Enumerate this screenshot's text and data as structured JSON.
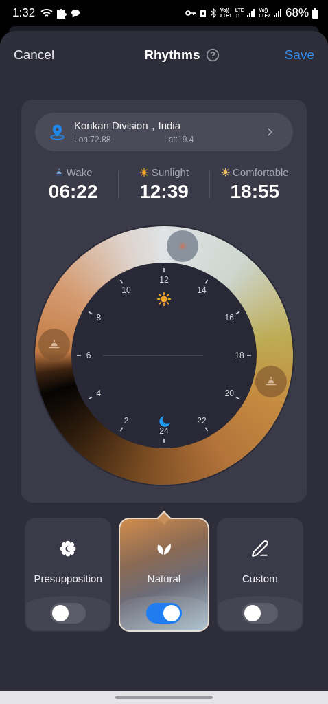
{
  "status_bar": {
    "time": "1:32",
    "signal_labels": [
      {
        "top": "Vo))",
        "bottom": "LTE1"
      },
      {
        "top": "LTE",
        "bottom": "↓↑"
      },
      {
        "top": "Vo))",
        "bottom": "LTE2"
      }
    ],
    "battery": "68%"
  },
  "header": {
    "cancel": "Cancel",
    "title": "Rhythms",
    "save": "Save"
  },
  "location": {
    "name": "Konkan Division，India",
    "lon": "Lon:72.88",
    "lat": "Lat:19.4"
  },
  "stats": [
    {
      "kind": "wake",
      "label": "Wake",
      "time": "06:22"
    },
    {
      "kind": "sunlight",
      "label": "Sunlight",
      "time": "12:39"
    },
    {
      "kind": "comfortable",
      "label": "Comfortable",
      "time": "18:55"
    }
  ],
  "dial": {
    "hours": [
      "2",
      "4",
      "6",
      "8",
      "10",
      "12",
      "14",
      "16",
      "18",
      "20",
      "22",
      "24"
    ]
  },
  "modes": [
    {
      "kind": "presupposition",
      "label": "Presupposition",
      "selected": false,
      "on": false
    },
    {
      "kind": "natural",
      "label": "Natural",
      "selected": true,
      "on": true
    },
    {
      "kind": "custom",
      "label": "Custom",
      "selected": false,
      "on": false
    }
  ]
}
